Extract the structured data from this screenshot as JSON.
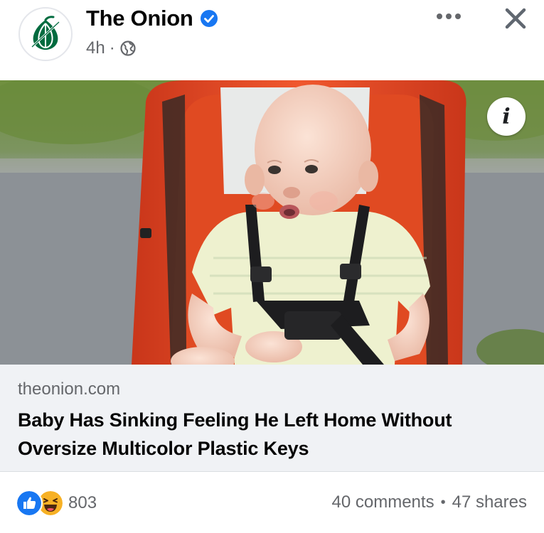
{
  "header": {
    "page_name": "The Onion",
    "timestamp": "4h",
    "meta_separator": "·",
    "verified_color": "#1877f2",
    "logo_color": "#006b3f",
    "icons": {
      "avatar": "onion-logo-icon",
      "verified": "verified-badge-icon",
      "audience": "globe-icon",
      "more": "more-options-icon",
      "close": "close-icon"
    }
  },
  "media": {
    "info_label": "i",
    "description_icon": "baby-in-stroller-photo"
  },
  "link_preview": {
    "domain": "theonion.com",
    "headline": "Baby Has Sinking Feeling He Left Home Without Oversize Multicolor Plastic Keys"
  },
  "footer": {
    "reaction_count": "803",
    "reaction_icons": [
      "like-icon",
      "haha-icon"
    ],
    "comments": "40 comments",
    "separator": "•",
    "shares": "47 shares",
    "like_color": "#1877f2",
    "haha_color": "#f7b125"
  }
}
